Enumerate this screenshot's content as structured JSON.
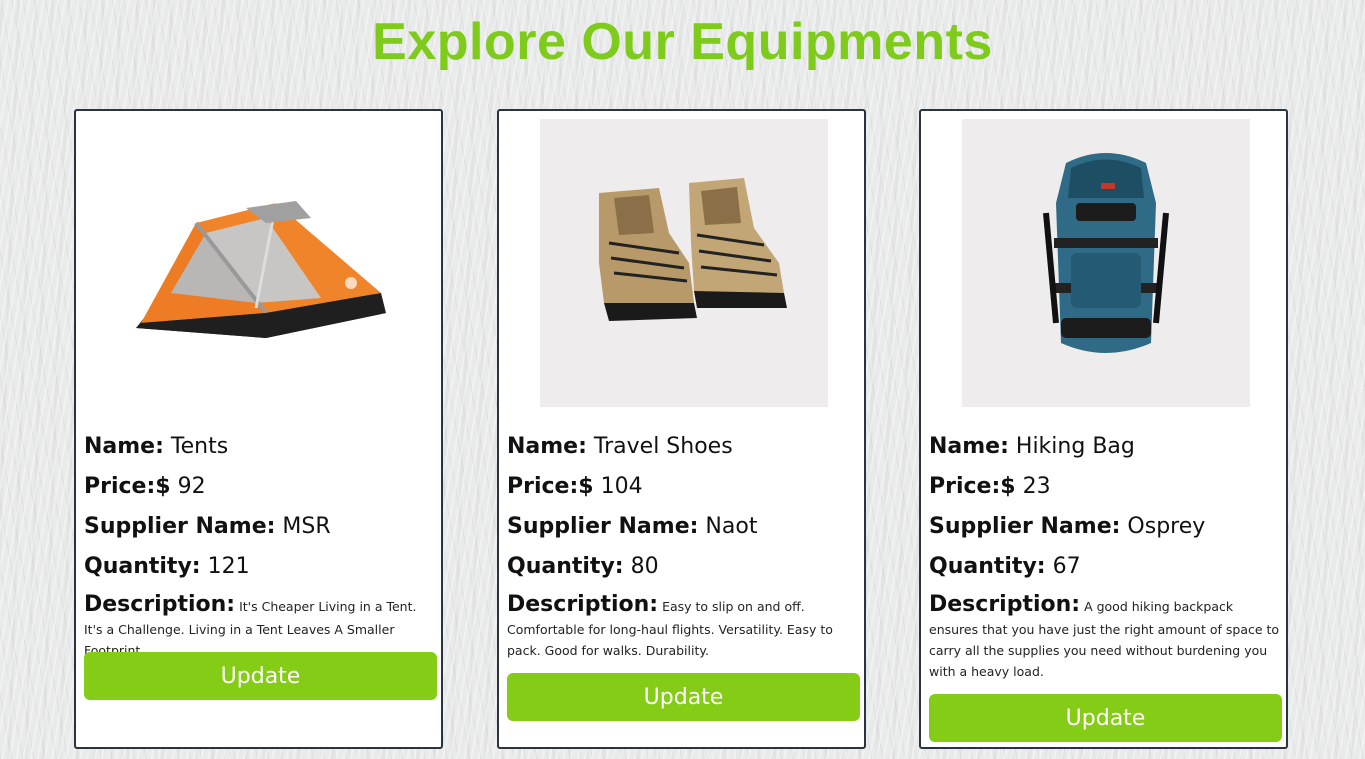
{
  "page": {
    "title": "Explore Our Equipments"
  },
  "labels": {
    "name": "Name:",
    "price": "Price:$",
    "supplier": "Supplier Name:",
    "quantity": "Quantity:",
    "description": "Description:"
  },
  "items": [
    {
      "name": "Tents",
      "price": "92",
      "supplier": "MSR",
      "quantity": "121",
      "description": "It's Cheaper Living in a Tent. It's a Challenge. Living in a Tent Leaves A Smaller Footprint.",
      "button": "Update",
      "image_icon": "tent-icon"
    },
    {
      "name": "Travel Shoes",
      "price": "104",
      "supplier": "Naot",
      "quantity": "80",
      "description": "Easy to slip on and off. Comfortable for long-haul flights. Versatility. Easy to pack. Good for walks. Durability.",
      "button": "Update",
      "image_icon": "boots-icon"
    },
    {
      "name": "Hiking Bag",
      "price": "23",
      "supplier": "Osprey",
      "quantity": "67",
      "description": "A good hiking backpack ensures that you have just the right amount of space to carry all the supplies you need without burdening you with a heavy load.",
      "button": "Update",
      "image_icon": "backpack-icon"
    }
  ],
  "colors": {
    "accent": "#84cc16",
    "title": "#7ecb1c",
    "card_border": "#2a3340"
  }
}
